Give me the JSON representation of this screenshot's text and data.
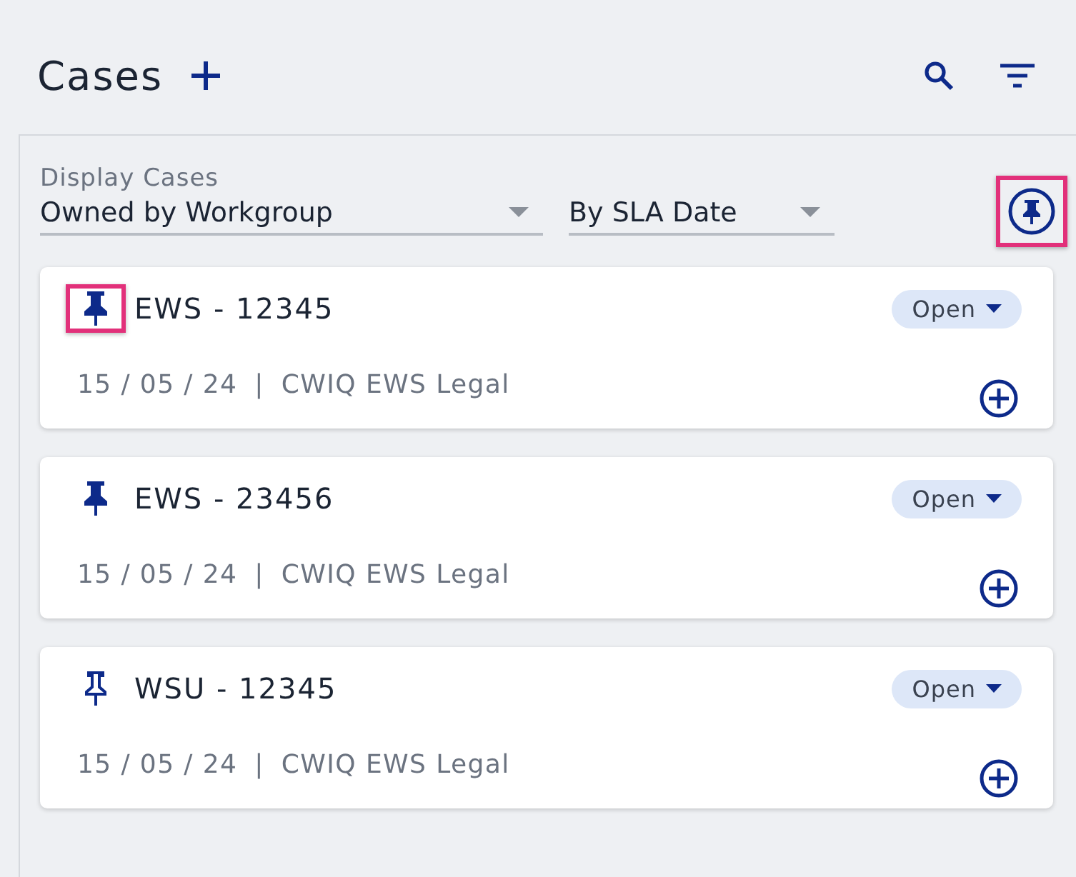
{
  "header": {
    "title": "Cases"
  },
  "filters": {
    "label": "Display Cases",
    "selects": [
      {
        "value": "Owned by Workgroup"
      },
      {
        "value": "By SLA Date"
      }
    ],
    "pin_toggle": {
      "highlighted": true
    }
  },
  "cases": [
    {
      "title": "EWS - 12345",
      "date": "15 / 05 / 24",
      "separator": "|",
      "group": "CWIQ EWS Legal",
      "status": "Open",
      "pinned": true,
      "highlighted": true
    },
    {
      "title": "EWS - 23456",
      "date": "15 / 05 / 24",
      "separator": "|",
      "group": "CWIQ EWS Legal",
      "status": "Open",
      "pinned": true,
      "highlighted": false
    },
    {
      "title": "WSU - 12345",
      "date": "15 / 05 / 24",
      "separator": "|",
      "group": "CWIQ EWS Legal",
      "status": "Open",
      "pinned": false,
      "highlighted": false
    }
  ]
}
